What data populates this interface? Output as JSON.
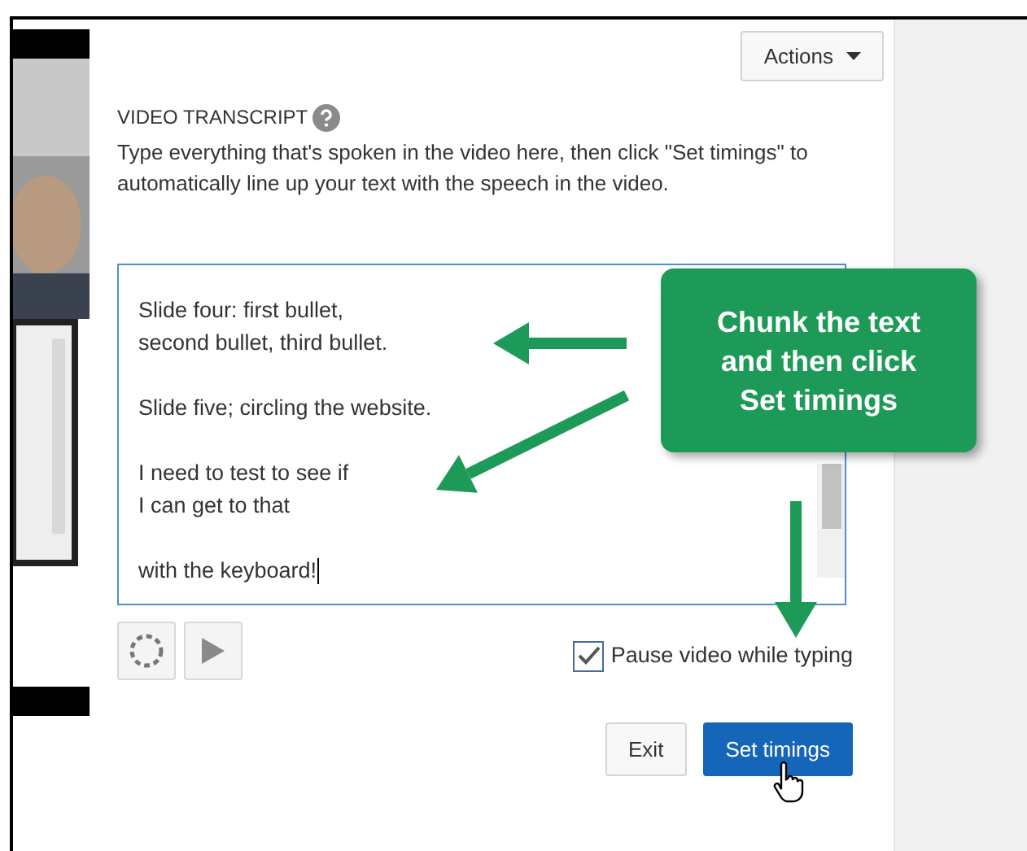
{
  "actions_button": {
    "label": "Actions"
  },
  "transcript": {
    "heading": "VIDEO TRANSCRIPT",
    "description": "Type everything that's spoken in the video here, then click \"Set timings\" to automatically line up your text with the speech in the video.",
    "value": "Slide four: first bullet,\nsecond bullet, third bullet.\n\nSlide five; circling the website.\n\nI need to test to see if\nI can get to that\n\nwith the keyboard!"
  },
  "pause_option": {
    "label": "Pause video while typing",
    "checked": true
  },
  "buttons": [
    {
      "label": "Exit",
      "kind": "secondary"
    },
    {
      "label": "Set timings",
      "kind": "primary"
    }
  ],
  "callout": {
    "text": "Chunk the text and then click Set timings"
  }
}
